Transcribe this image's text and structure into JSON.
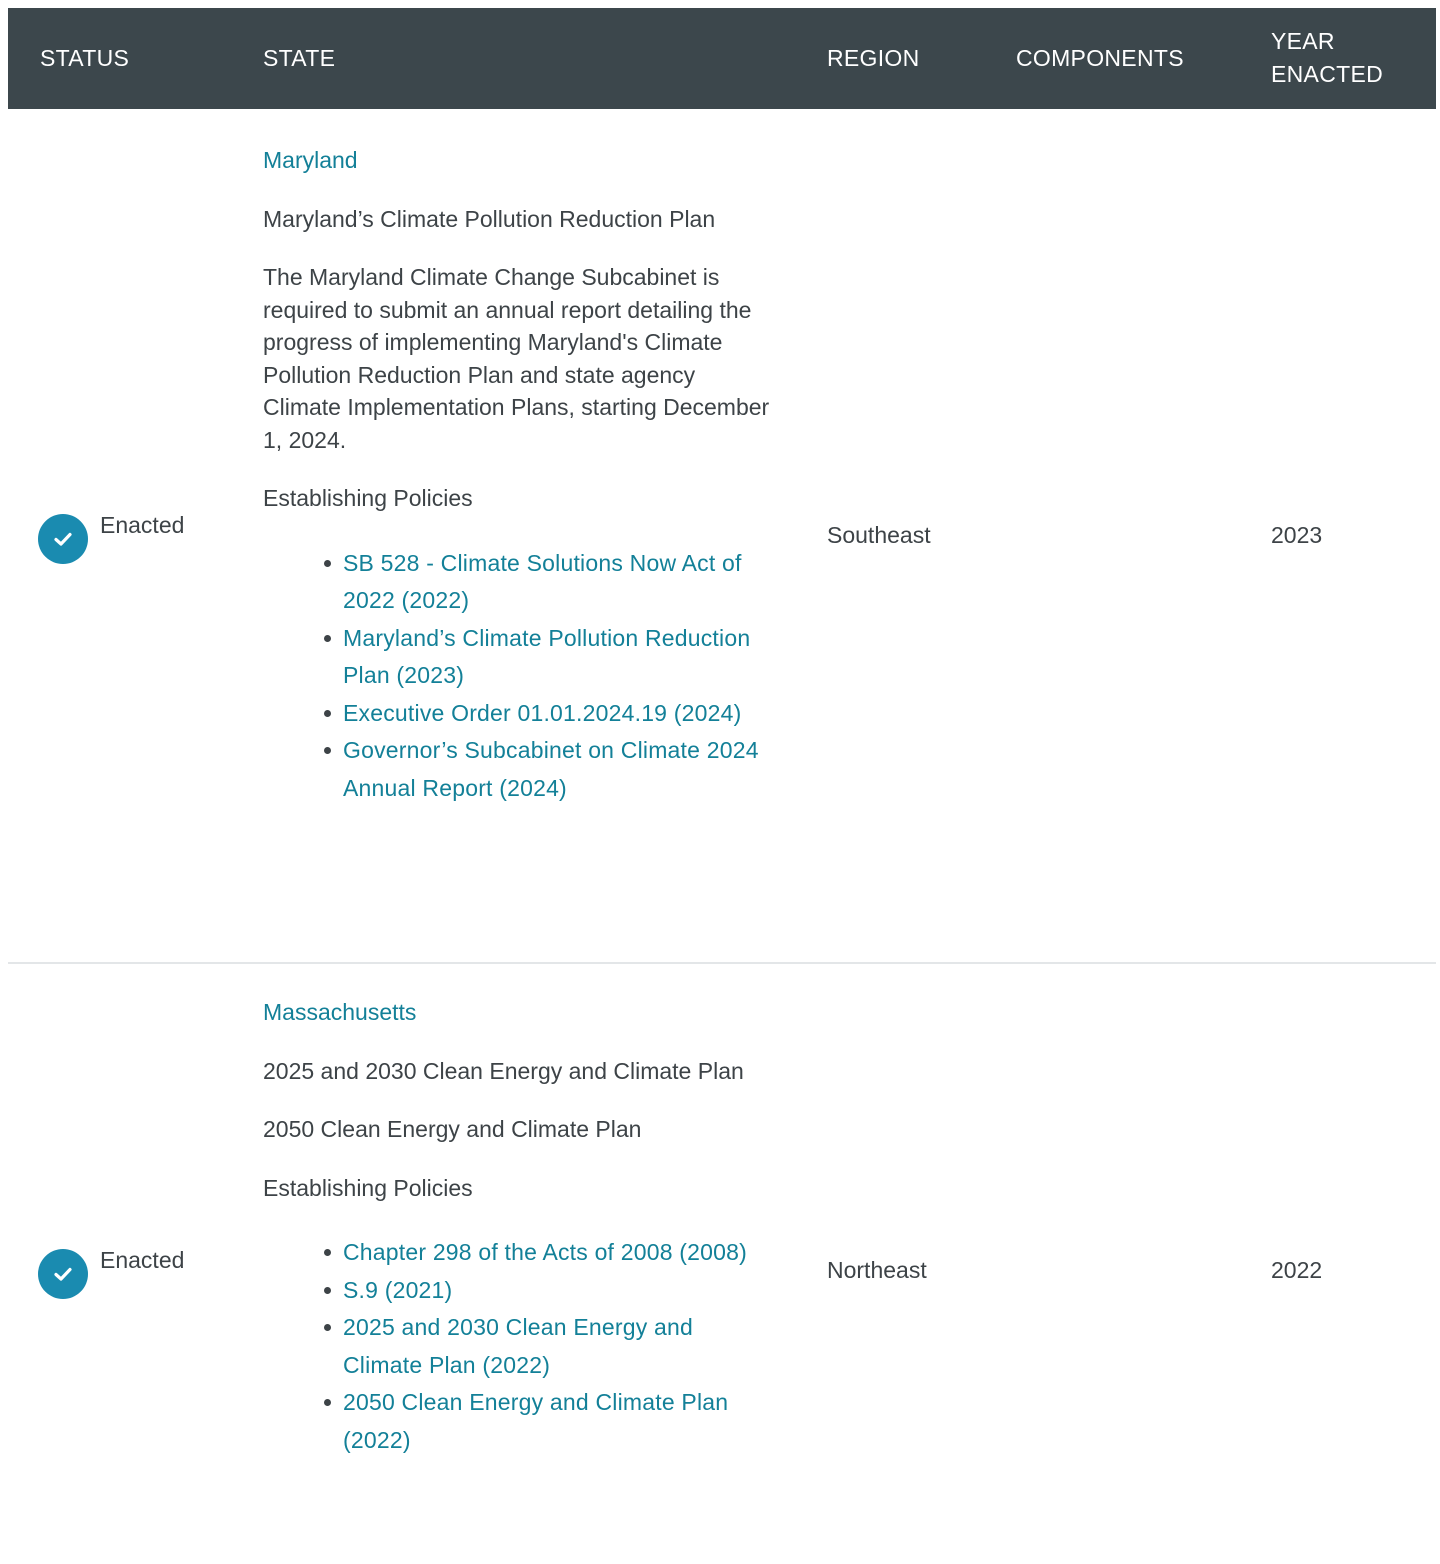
{
  "header": {
    "status": "STATUS",
    "state": "STATE",
    "region": "REGION",
    "components": "COMPONENTS",
    "year": "YEAR ENACTED"
  },
  "rows": [
    {
      "status": "Enacted",
      "state_name": "Maryland",
      "plan_title": "Maryland’s Climate Pollution Reduction Plan",
      "description": "The Maryland Climate Change Subcabinet is required to submit an annual report detailing the progress of implementing Maryland's Climate Pollution Reduction Plan and state agency Climate Implementation Plans, starting December 1, 2024.",
      "policies_heading": "Establishing Policies",
      "policies": [
        "SB 528 - Climate Solutions Now Act of 2022 (2022)",
        "Maryland’s Climate Pollution Reduction Plan (2023)",
        "Executive Order 01.01.2024.19 (2024)",
        "Governor’s Subcabinet on Climate 2024 Annual Report (2024)"
      ],
      "region": "Southeast",
      "year": "2023"
    },
    {
      "status": "Enacted",
      "state_name": "Massachusetts",
      "plan_title": "2025 and 2030 Clean Energy and Climate Plan",
      "plan_title_2": "2050 Clean Energy and Climate Plan",
      "policies_heading": "Establishing Policies",
      "policies": [
        "Chapter 298 of the Acts of 2008 (2008)",
        "S.9 (2021)",
        "2025 and 2030 Clean Energy and Climate Plan (2022)",
        "2050 Clean Energy and Climate Plan (2022)"
      ],
      "region": "Northeast",
      "year": "2022"
    }
  ],
  "colors": {
    "header_bg": "#3c474c",
    "link": "#138098",
    "check_badge": "#1a8bb0"
  },
  "icons": {
    "status": "check-circle-icon"
  }
}
